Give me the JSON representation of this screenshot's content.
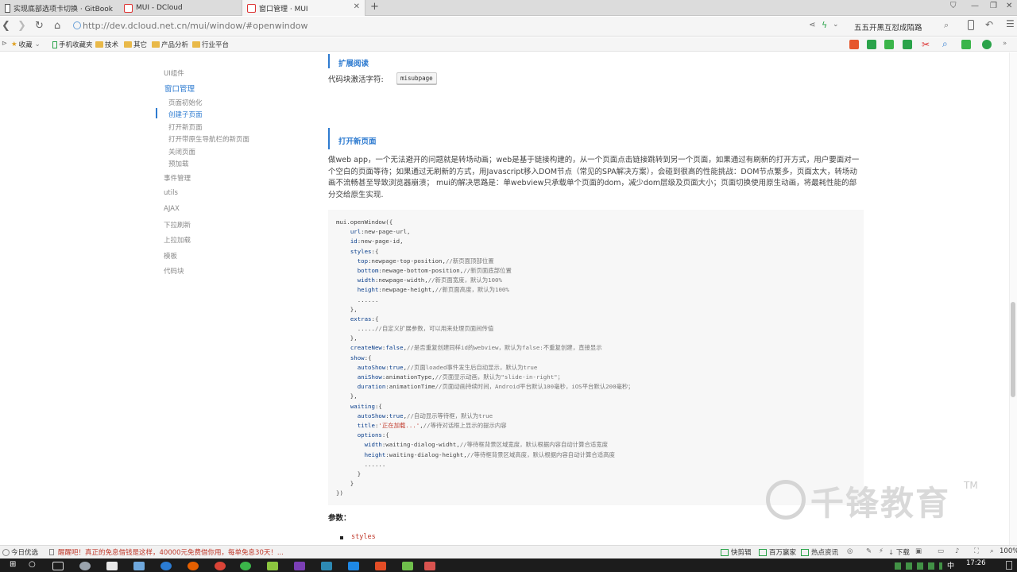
{
  "browser": {
    "tabs": [
      {
        "title": "实现底部选项卡切换 · GitBook",
        "icon": "gitbook-icon",
        "active": false
      },
      {
        "title": "MUI - DCloud",
        "icon": "dcloud-icon",
        "active": false
      },
      {
        "title": "窗口管理 · MUI",
        "icon": "dcloud-icon",
        "active": true
      }
    ],
    "new_tab_symbol": "+",
    "url_host": "http://dev.dcloud.net.cn",
    "url_path": "/mui/window/#openwindow",
    "search_text": "五五开黑互怼成陌路",
    "bookmarks": [
      "收藏",
      "手机收藏夹",
      "技术",
      "其它",
      "产品分析",
      "行业平台"
    ]
  },
  "sidebar": {
    "items": [
      {
        "label": "UI组件",
        "type": "normal"
      },
      {
        "label": "窗口管理",
        "type": "group"
      },
      {
        "label": "页面初始化",
        "type": "sub"
      },
      {
        "label": "创建子页面",
        "type": "current"
      },
      {
        "label": "打开新页面",
        "type": "sub"
      },
      {
        "label": "打开带原生导航栏的新页面",
        "type": "sub"
      },
      {
        "label": "关闭页面",
        "type": "sub"
      },
      {
        "label": "预加载",
        "type": "sub"
      },
      {
        "label": "事件管理",
        "type": "normal"
      },
      {
        "label": "utils",
        "type": "normal"
      },
      {
        "label": "AJAX",
        "type": "normal"
      },
      {
        "label": "下拉刷新",
        "type": "normal"
      },
      {
        "label": "上拉加载",
        "type": "normal"
      },
      {
        "label": "模板",
        "type": "normal"
      },
      {
        "label": "代码块",
        "type": "normal"
      }
    ]
  },
  "content": {
    "ext_heading": "扩展阅读",
    "trigger_label": "代码块激活字符:",
    "trigger_code": "misubpage",
    "open_heading": "打开新页面",
    "paragraph": "做web app，一个无法避开的问题就是转场动画；web是基于链接构建的，从一个页面点击链接跳转到另一个页面，如果通过有刷新的打开方式，用户要面对一个空白的页面等待；如果通过无刷新的方式，用Javascript移入DOM节点（常见的SPA解决方案），会碰到很高的性能挑战：DOM节点繁多，页面太大，转场动画不流畅甚至导致浏览器崩溃； mui的解决思路是：单webview只承载单个页面的dom，减少dom层级及页面大小；页面切换使用原生动画，将最耗性能的部分交给原生实现.",
    "code_lines": [
      "mui.openWindow({",
      "    url:new-page-url,",
      "    id:new-page-id,",
      "    styles:{",
      "      top:newpage-top-position,//新页面顶部位置",
      "      bottom:newage-bottom-position,//新页面底部位置",
      "      width:newpage-width,//新页面宽度，默认为100%",
      "      height:newpage-height,//新页面高度，默认为100%",
      "      ......",
      "    },",
      "    extras:{",
      "      .....//自定义扩展参数，可以用来处理页面间传值",
      "    },",
      "    createNew:false,//是否重复创建同样id的webview，默认为false:不重复创建，直接显示",
      "    show:{",
      "      autoShow:true,//页面loaded事件发生后自动显示，默认为true",
      "      aniShow:animationType,//页面显示动画，默认为\"slide-in-right\"；",
      "      duration:animationTime//页面动画持续时间，Android平台默认100毫秒，iOS平台默认200毫秒；",
      "    },",
      "    waiting:{",
      "      autoShow:true,//自动显示等待框，默认为true",
      "      title:'正在加载...',//等待对话框上显示的提示内容",
      "      options:{",
      "        width:waiting-dialog-widht,//等待框背景区域宽度，默认根据内容自动计算合适宽度",
      "        height:waiting-dialog-height,//等待框背景区域高度，默认根据内容自动计算合适高度",
      "        ......",
      "      }",
      "    }",
      "})"
    ],
    "params_label": "参数：",
    "first_param": "styles"
  },
  "watermark": {
    "text": "千锋教育",
    "tm": "TM"
  },
  "statusbar": {
    "left_label": "今日优选",
    "ticker": "醒醒吧！真正的免息借钱是这样，40000元免费借你用，每单免息30天！...",
    "right_items": [
      "快剪辑",
      "百万赢家",
      "热点资讯",
      "下载",
      "100%"
    ]
  },
  "taskbar": {
    "time": "17:26"
  },
  "colors": {
    "accent": "#2e7bd0",
    "string": "#c0392b"
  }
}
